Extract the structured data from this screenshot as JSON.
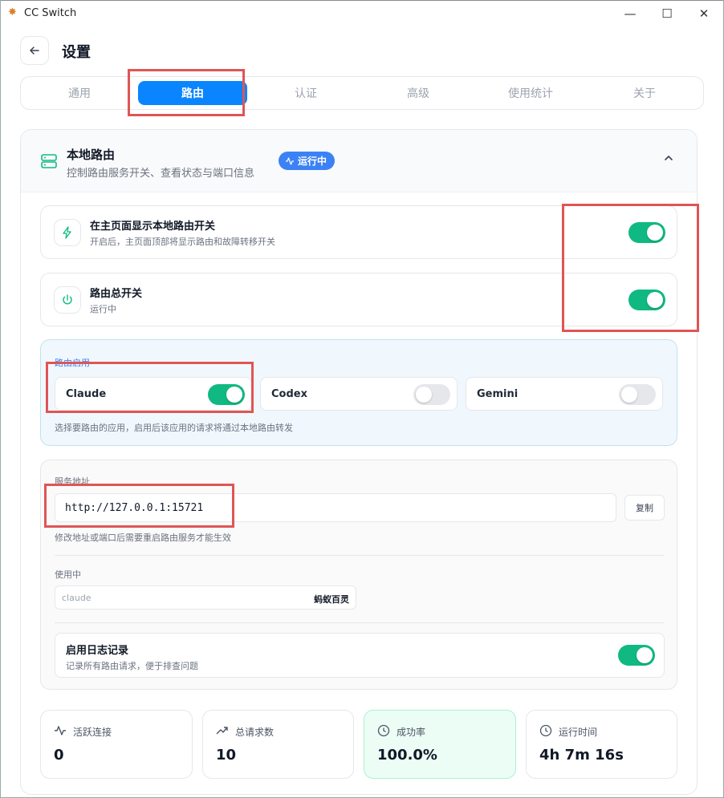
{
  "window": {
    "title": "CC Switch",
    "controls": {
      "minimize": "—",
      "maximize": "☐",
      "close": "✕"
    }
  },
  "header": {
    "title": "设置"
  },
  "tabs": [
    {
      "label": "通用",
      "active": false
    },
    {
      "label": "路由",
      "active": true
    },
    {
      "label": "认证",
      "active": false
    },
    {
      "label": "高级",
      "active": false
    },
    {
      "label": "使用统计",
      "active": false
    },
    {
      "label": "关于",
      "active": false
    }
  ],
  "section": {
    "title": "本地路由",
    "subtitle": "控制路由服务开关、查看状态与端口信息",
    "badge": "运行中",
    "icon": "server-icon"
  },
  "settings": {
    "show_toggle": {
      "title": "在主页面显示本地路由开关",
      "subtitle": "开启后，主页面顶部将显示路由和故障转移开关",
      "on": true,
      "icon": "zap-icon"
    },
    "master_switch": {
      "title": "路由总开关",
      "subtitle": "运行中",
      "on": true,
      "icon": "power-icon"
    }
  },
  "apps": {
    "label": "路由启用",
    "items": [
      {
        "name": "Claude",
        "on": true
      },
      {
        "name": "Codex",
        "on": false
      },
      {
        "name": "Gemini",
        "on": false
      }
    ],
    "hint": "选择要路由的应用，启用后该应用的请求将通过本地路由转发"
  },
  "service": {
    "label": "服务地址",
    "address": "http://127.0.0.1:15721",
    "copy_label": "复制",
    "hint": "修改地址或端口后需要重启路由服务才能生效",
    "inuse_label": "使用中",
    "inuse_app": "claude",
    "inuse_provider": "蚂蚁百灵",
    "log": {
      "title": "启用日志记录",
      "subtitle": "记录所有路由请求，便于排查问题",
      "on": true
    }
  },
  "stats": [
    {
      "label": "活跃连接",
      "value": "0",
      "icon": "activity-icon"
    },
    {
      "label": "总请求数",
      "value": "10",
      "icon": "trending-up-icon"
    },
    {
      "label": "成功率",
      "value": "100.0%",
      "icon": "clock-icon"
    },
    {
      "label": "运行时间",
      "value": "4h 7m 16s",
      "icon": "clock-icon"
    }
  ],
  "colors": {
    "accent": "#0a84ff",
    "toggle_on": "#10b981",
    "badge": "#3b82f6",
    "annotation": "#e05555"
  }
}
